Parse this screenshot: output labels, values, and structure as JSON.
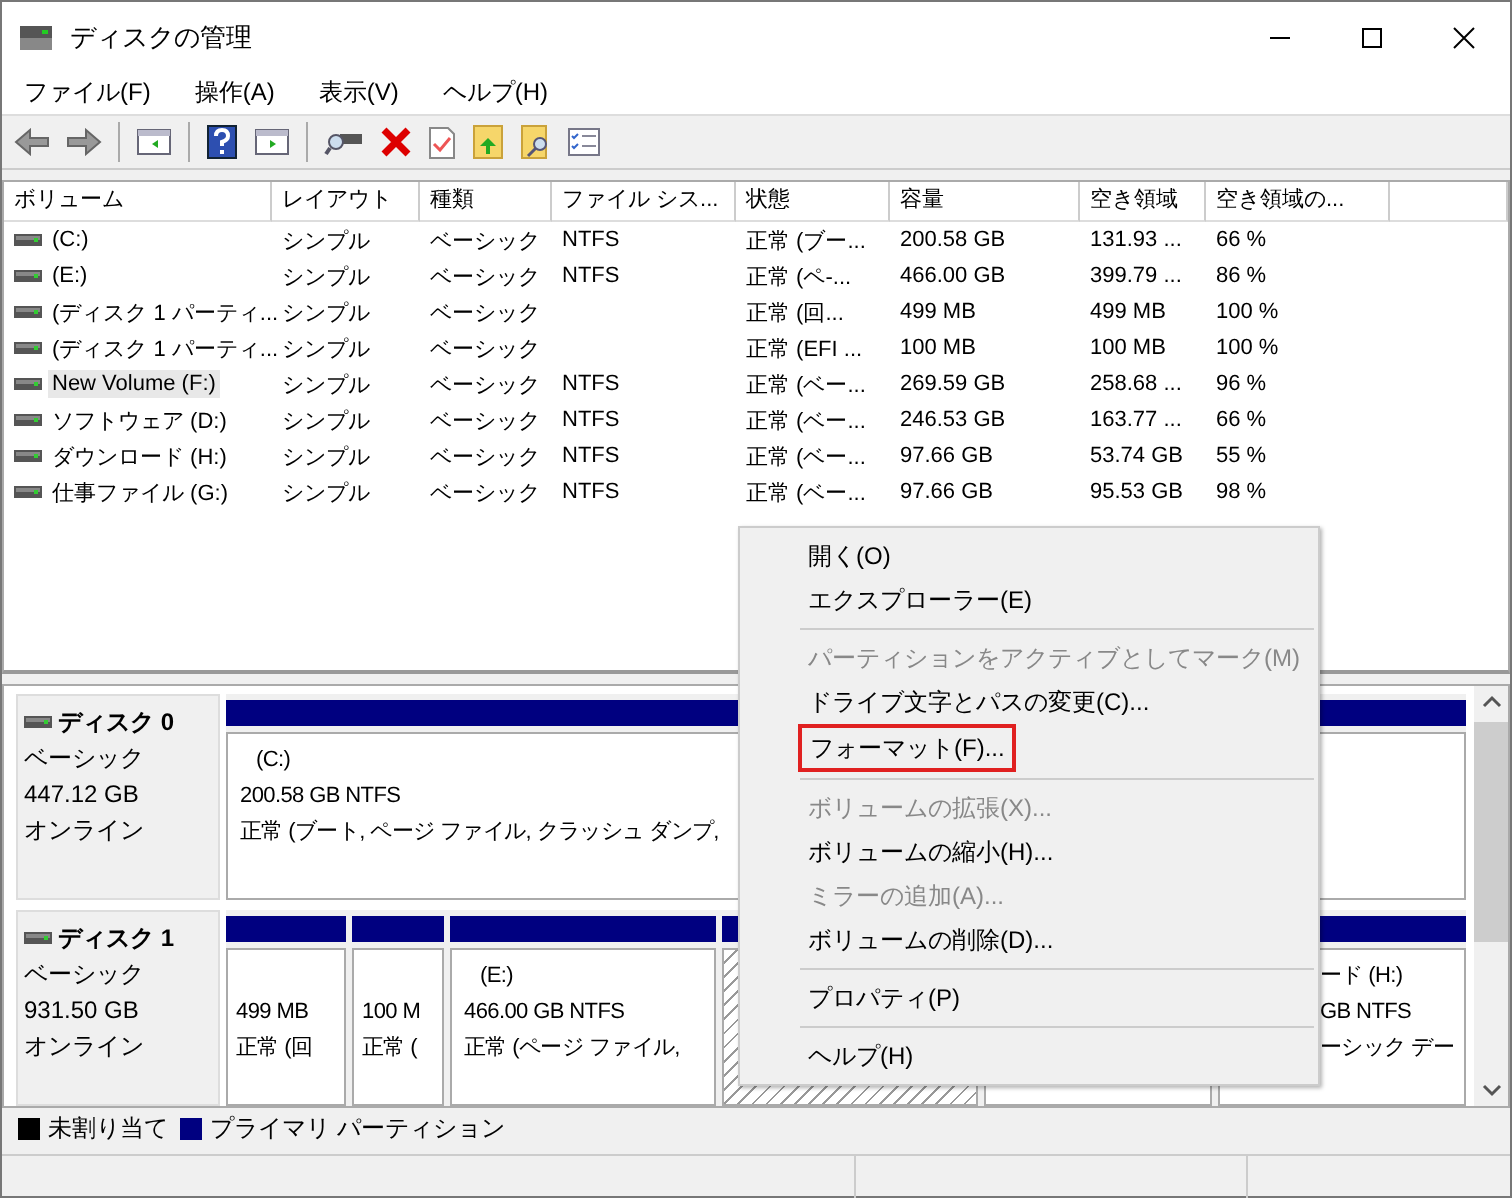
{
  "window": {
    "title": "ディスクの管理"
  },
  "menu": [
    "ファイル(F)",
    "操作(A)",
    "表示(V)",
    "ヘルプ(H)"
  ],
  "volume_table": {
    "columns": [
      "ボリューム",
      "レイアウト",
      "種類",
      "ファイル シス...",
      "状態",
      "容量",
      "空き領域",
      "空き領域の..."
    ],
    "rows": [
      {
        "selected": false,
        "cells": [
          "(C:)",
          "シンプル",
          "ベーシック",
          "NTFS",
          "正常 (ブー...",
          "200.58 GB",
          "131.93 ...",
          "66 %"
        ]
      },
      {
        "selected": false,
        "cells": [
          "(E:)",
          "シンプル",
          "ベーシック",
          "NTFS",
          "正常 (ペ-...",
          "466.00 GB",
          "399.79 ...",
          "86 %"
        ]
      },
      {
        "selected": false,
        "cells": [
          "(ディスク 1 パーティ...",
          "シンプル",
          "ベーシック",
          "",
          "正常 (回...",
          "499 MB",
          "499 MB",
          "100 %"
        ]
      },
      {
        "selected": false,
        "cells": [
          "(ディスク 1 パーティ...",
          "シンプル",
          "ベーシック",
          "",
          "正常 (EFI ...",
          "100 MB",
          "100 MB",
          "100 %"
        ]
      },
      {
        "selected": true,
        "cells": [
          "New Volume (F:)",
          "シンプル",
          "ベーシック",
          "NTFS",
          "正常 (ベー...",
          "269.59 GB",
          "258.68 ...",
          "96 %"
        ]
      },
      {
        "selected": false,
        "cells": [
          "ソフトウェア (D:)",
          "シンプル",
          "ベーシック",
          "NTFS",
          "正常 (ベー...",
          "246.53 GB",
          "163.77 ...",
          "66 %"
        ]
      },
      {
        "selected": false,
        "cells": [
          "ダウンロード (H:)",
          "シンプル",
          "ベーシック",
          "NTFS",
          "正常 (ベー...",
          "97.66 GB",
          "53.74 GB",
          "55 %"
        ]
      },
      {
        "selected": false,
        "cells": [
          "仕事ファイル (G:)",
          "シンプル",
          "ベーシック",
          "NTFS",
          "正常 (ベー...",
          "97.66 GB",
          "95.53 GB",
          "98 %"
        ]
      }
    ]
  },
  "disks": [
    {
      "name": "ディスク 0",
      "type": "ベーシック",
      "size": "447.12 GB",
      "status": "オンライン",
      "partitions": [
        {
          "selected": false,
          "title": "(C:)",
          "lines": [
            "200.58 GB NTFS",
            "正常 (ブート, ページ ファイル, クラッシュ ダンプ,"
          ]
        }
      ]
    },
    {
      "name": "ディスク 1",
      "type": "ベーシック",
      "size": "931.50 GB",
      "status": "オンライン",
      "partitions": [
        {
          "selected": false,
          "lines": [
            "499 MB",
            "正常 (回"
          ]
        },
        {
          "selected": false,
          "lines": [
            "100 M",
            "正常 ("
          ]
        },
        {
          "selected": false,
          "title": "(E:)",
          "lines": [
            "466.00 GB NTFS",
            "正常 (ページ ファイル,"
          ]
        },
        {
          "selected": true
        },
        {
          "selected": false
        },
        {
          "selected": false,
          "title": "ード (H:)",
          "lines": [
            "GB NTFS",
            "ーシック デー"
          ]
        }
      ]
    }
  ],
  "legend": [
    {
      "label": "未割り当て",
      "color": "#000000"
    },
    {
      "label": "プライマリ パーティション",
      "color": "#000080"
    }
  ],
  "context_menu": [
    {
      "kind": "item",
      "label": "開く(O)",
      "disabled": false,
      "highlighted": false
    },
    {
      "kind": "item",
      "label": "エクスプローラー(E)",
      "disabled": false,
      "highlighted": false
    },
    {
      "kind": "separator"
    },
    {
      "kind": "item",
      "label": "パーティションをアクティブとしてマーク(M)",
      "disabled": true,
      "highlighted": false
    },
    {
      "kind": "item",
      "label": "ドライブ文字とパスの変更(C)...",
      "disabled": false,
      "highlighted": false
    },
    {
      "kind": "item",
      "label": "フォーマット(F)...",
      "disabled": false,
      "highlighted": true
    },
    {
      "kind": "separator"
    },
    {
      "kind": "item",
      "label": "ボリュームの拡張(X)...",
      "disabled": true,
      "highlighted": false
    },
    {
      "kind": "item",
      "label": "ボリュームの縮小(H)...",
      "disabled": false,
      "highlighted": false
    },
    {
      "kind": "item",
      "label": "ミラーの追加(A)...",
      "disabled": true,
      "highlighted": false
    },
    {
      "kind": "item",
      "label": "ボリュームの削除(D)...",
      "disabled": false,
      "highlighted": false
    },
    {
      "kind": "separator"
    },
    {
      "kind": "item",
      "label": "プロパティ(P)",
      "disabled": false,
      "highlighted": false
    },
    {
      "kind": "separator"
    },
    {
      "kind": "item",
      "label": "ヘルプ(H)",
      "disabled": false,
      "highlighted": false
    }
  ]
}
